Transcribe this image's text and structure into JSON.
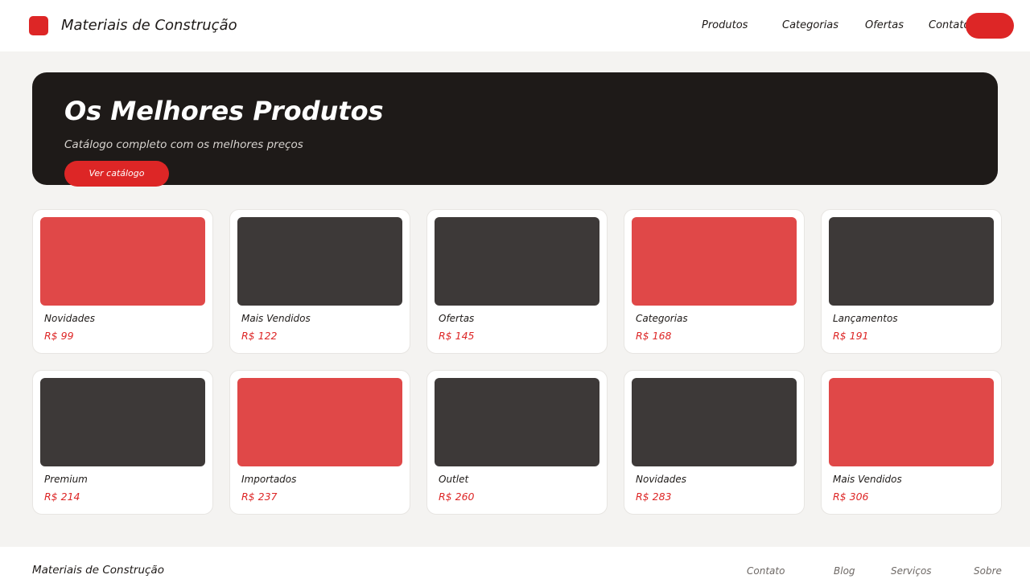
{
  "colors": {
    "accent": "#dd2626",
    "dark": "#1e1a18",
    "tile_red": "#e04848",
    "tile_dark": "#3d3938",
    "background": "#f4f3f1"
  },
  "header": {
    "brand": "Materiais de Construção",
    "nav": [
      "Produtos",
      "Categorias",
      "Ofertas",
      "Contato"
    ]
  },
  "hero": {
    "title": "Os Melhores Produtos",
    "subtitle": "Catálogo completo com os melhores preços",
    "cta_label": "Ver catálogo"
  },
  "products": [
    {
      "name": "Novidades",
      "price": "R$ 99",
      "tone": "red"
    },
    {
      "name": "Mais Vendidos",
      "price": "R$ 122",
      "tone": "dark"
    },
    {
      "name": "Ofertas",
      "price": "R$ 145",
      "tone": "dark"
    },
    {
      "name": "Categorias",
      "price": "R$ 168",
      "tone": "red"
    },
    {
      "name": "Lançamentos",
      "price": "R$ 191",
      "tone": "dark"
    },
    {
      "name": "Premium",
      "price": "R$ 214",
      "tone": "dark"
    },
    {
      "name": "Importados",
      "price": "R$ 237",
      "tone": "red"
    },
    {
      "name": "Outlet",
      "price": "R$ 260",
      "tone": "dark"
    },
    {
      "name": "Novidades",
      "price": "R$ 283",
      "tone": "dark"
    },
    {
      "name": "Mais Vendidos",
      "price": "R$ 306",
      "tone": "red"
    }
  ],
  "footer": {
    "brand": "Materiais de Construção",
    "links": [
      "Contato",
      "Blog",
      "Serviços",
      "Sobre"
    ]
  }
}
